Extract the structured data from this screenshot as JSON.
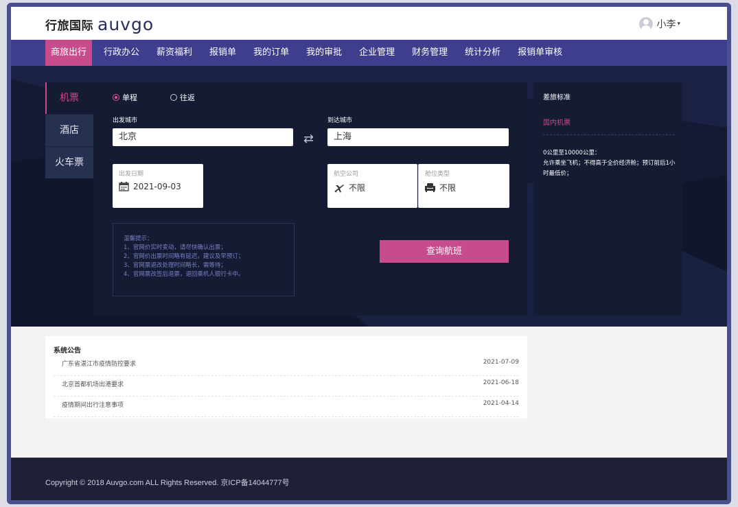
{
  "brand": {
    "name_cn": "行旅国际",
    "name_en": "auvgo"
  },
  "user": {
    "name": "小李",
    "caret": "▾"
  },
  "nav": {
    "items": [
      "商旅出行",
      "行政办公",
      "薪资福利",
      "报销单",
      "我的订单",
      "我的审批",
      "企业管理",
      "财务管理",
      "统计分析",
      "报销单审核"
    ],
    "active_index": 0
  },
  "side_tabs": {
    "items": [
      "机票",
      "酒店",
      "火车票"
    ],
    "active_index": 0
  },
  "booking": {
    "trip_types": [
      "单程",
      "往返"
    ],
    "selected_trip": "单程",
    "from_label": "出发城市",
    "from_value": "北京",
    "to_label": "到达城市",
    "to_value": "上海",
    "swap_icon": "swap-arrows-icon",
    "date_label": "出发日期",
    "date_value": "2021-09-03",
    "airline_label": "航空公司",
    "airline_value": "不限",
    "cabin_label": "舱位类型",
    "cabin_value": "不限",
    "tips_title": "温馨提示：",
    "tips": [
      "1、官网价实时变动，请尽快确认出票；",
      "2、官网价出票时间略有延迟，建议及早预订；",
      "3、官网票退改处理时间略长，需等待；",
      "4、官网票改签后退票，退回乘机人银行卡中。"
    ],
    "search_button": "查询航班"
  },
  "policy": {
    "title": "差旅标准",
    "subtitle": "国内机票",
    "lines": [
      "0公里至10000公里：",
      "允许乘坐飞机；不得高于全价经济舱；预订前后1小时最低价；"
    ]
  },
  "notices": {
    "title": "系统公告",
    "items": [
      {
        "title": "广东省湛江市疫情防控要求",
        "date": "2021-07-09"
      },
      {
        "title": "北京首都机场出港要求",
        "date": "2021-06-18"
      },
      {
        "title": "疫情期间出行注意事项",
        "date": "2021-04-14"
      }
    ]
  },
  "footer": {
    "copyright": "Copyright © 2018 Auvgo.com ALL Rights Reserved. 京ICP备14044777号"
  },
  "colors": {
    "accent": "#c84b8c",
    "nav_bg": "#3e3d8e",
    "hero_bg": "#141a33",
    "frame": "#4a4f8e",
    "footer_bg": "#1d2036"
  }
}
